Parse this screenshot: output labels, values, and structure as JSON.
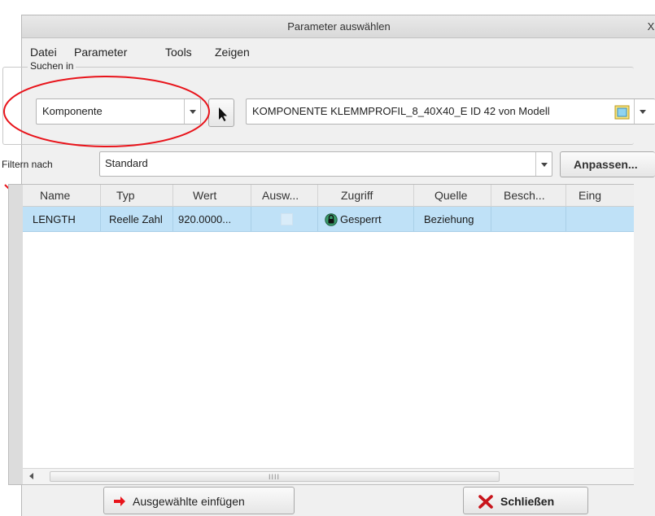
{
  "window": {
    "title": "Parameter auswählen",
    "close_symbol": "X"
  },
  "menu": [
    "Datei",
    "Parameter",
    "Tools",
    "Zeigen"
  ],
  "search_group": {
    "legend": "Suchen in",
    "scope_value": "Komponente",
    "pick_icon": "mouse-pointer-icon",
    "model_value": "KOMPONENTE KLEMMPROFIL_8_40X40_E ID 42 von Modell",
    "model_icon": "part-cube-icon"
  },
  "filter": {
    "label": "Filtern nach",
    "value": "Standard",
    "customize_label": "Anpassen..."
  },
  "table": {
    "columns": [
      "Name",
      "Typ",
      "Wert",
      "Ausw...",
      "Zugriff",
      "Quelle",
      "Besch...",
      "Eing"
    ],
    "rows": [
      {
        "name": "LENGTH",
        "type": "Reelle Zahl",
        "value": "920.0000...",
        "designated": false,
        "access": "Gesperrt",
        "access_icon": "lock-icon",
        "source": "Beziehung",
        "description": "",
        "input": ""
      }
    ],
    "scroll_grip": "IIII"
  },
  "buttons": {
    "insert_label": "Ausgewählte einfügen",
    "close_label": "Schließen"
  },
  "colors": {
    "selection": "#bfe1f7",
    "annotation_red": "#e8141b",
    "insert_arrow": "#e8141b",
    "close_x": "#c8141b"
  }
}
